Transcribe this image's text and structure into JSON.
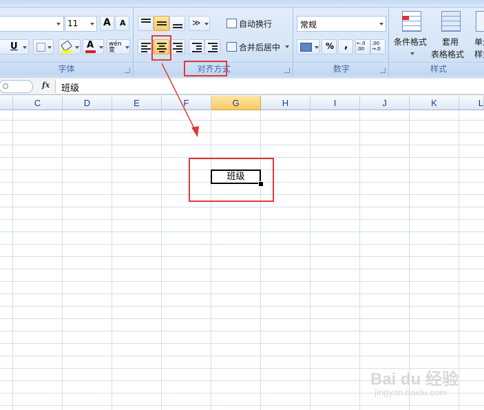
{
  "ribbon": {
    "font_group": {
      "label": "字体",
      "size_value": "11",
      "underline": "U",
      "grow_font": "A",
      "shrink_font": "A",
      "font_color_glyph": "A",
      "phonetic_glyph": "wén 变"
    },
    "alignment_group": {
      "label": "对齐方式",
      "wrap_text": "自动换行",
      "merge_center": "合并后居中"
    },
    "number_group": {
      "label": "数字",
      "format_value": "常规",
      "percent": "%",
      "comma": ",",
      "inc_decimal": "←.0 .00",
      "dec_decimal": ".00 →.0"
    },
    "styles_group": {
      "label": "样式",
      "conditional_format": "条件格式",
      "table_format_1": "套用",
      "table_format_2": "表格格式",
      "cell_styles_1": "单元",
      "cell_styles_2": "样式"
    }
  },
  "formula_bar": {
    "fx": "fx",
    "content": "班级"
  },
  "columns": [
    "C",
    "D",
    "E",
    "F",
    "G",
    "H",
    "I",
    "J",
    "K",
    "L"
  ],
  "selected_column": "G",
  "active_cell": {
    "value": "班级"
  },
  "watermark": {
    "brand": "Bai du 经验",
    "url": "jingyan.baidu.com"
  },
  "colors": {
    "ribbon": "#dbe8f8",
    "highlight": "#e23737",
    "selected_header": "#f8c963",
    "grid": "#d6dde8"
  }
}
